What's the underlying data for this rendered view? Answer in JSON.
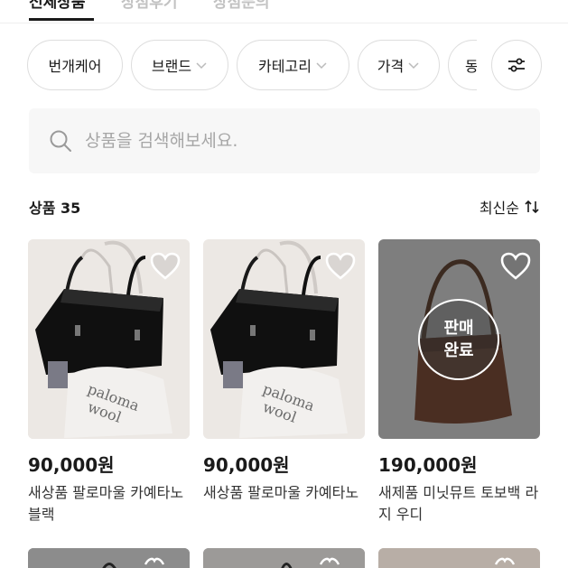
{
  "tabs": [
    {
      "label": "전체상품",
      "active": true
    },
    {
      "label": "상점후기",
      "active": false
    },
    {
      "label": "상점문의",
      "active": false
    }
  ],
  "filters": [
    {
      "label": "번개케어",
      "dropdown": false
    },
    {
      "label": "브랜드",
      "dropdown": true
    },
    {
      "label": "카테고리",
      "dropdown": true
    },
    {
      "label": "가격",
      "dropdown": true
    },
    {
      "label": "동",
      "dropdown": false
    }
  ],
  "search": {
    "placeholder": "상품을 검색해보세요."
  },
  "product_count": "상품 35",
  "sort_label": "최신순",
  "products": [
    {
      "price": "90,000원",
      "title": "새상품 팔로마울 카예타노 블랙",
      "sold": false,
      "image": "black-leather-bag"
    },
    {
      "price": "90,000원",
      "title": "새상품 팔로마울 카예타노",
      "sold": false,
      "image": "black-leather-bag"
    },
    {
      "price": "190,000원",
      "title": "새제품 미닛뮤트 토보백 라지 우디",
      "sold": true,
      "image": "brown-tote-bag"
    }
  ],
  "sold_label_line1": "판매",
  "sold_label_line2": "완료",
  "colors": {
    "text": "#1a1a1a",
    "muted": "#a6a6a6",
    "border": "#dddddd",
    "search_bg": "#f7f7f7"
  }
}
